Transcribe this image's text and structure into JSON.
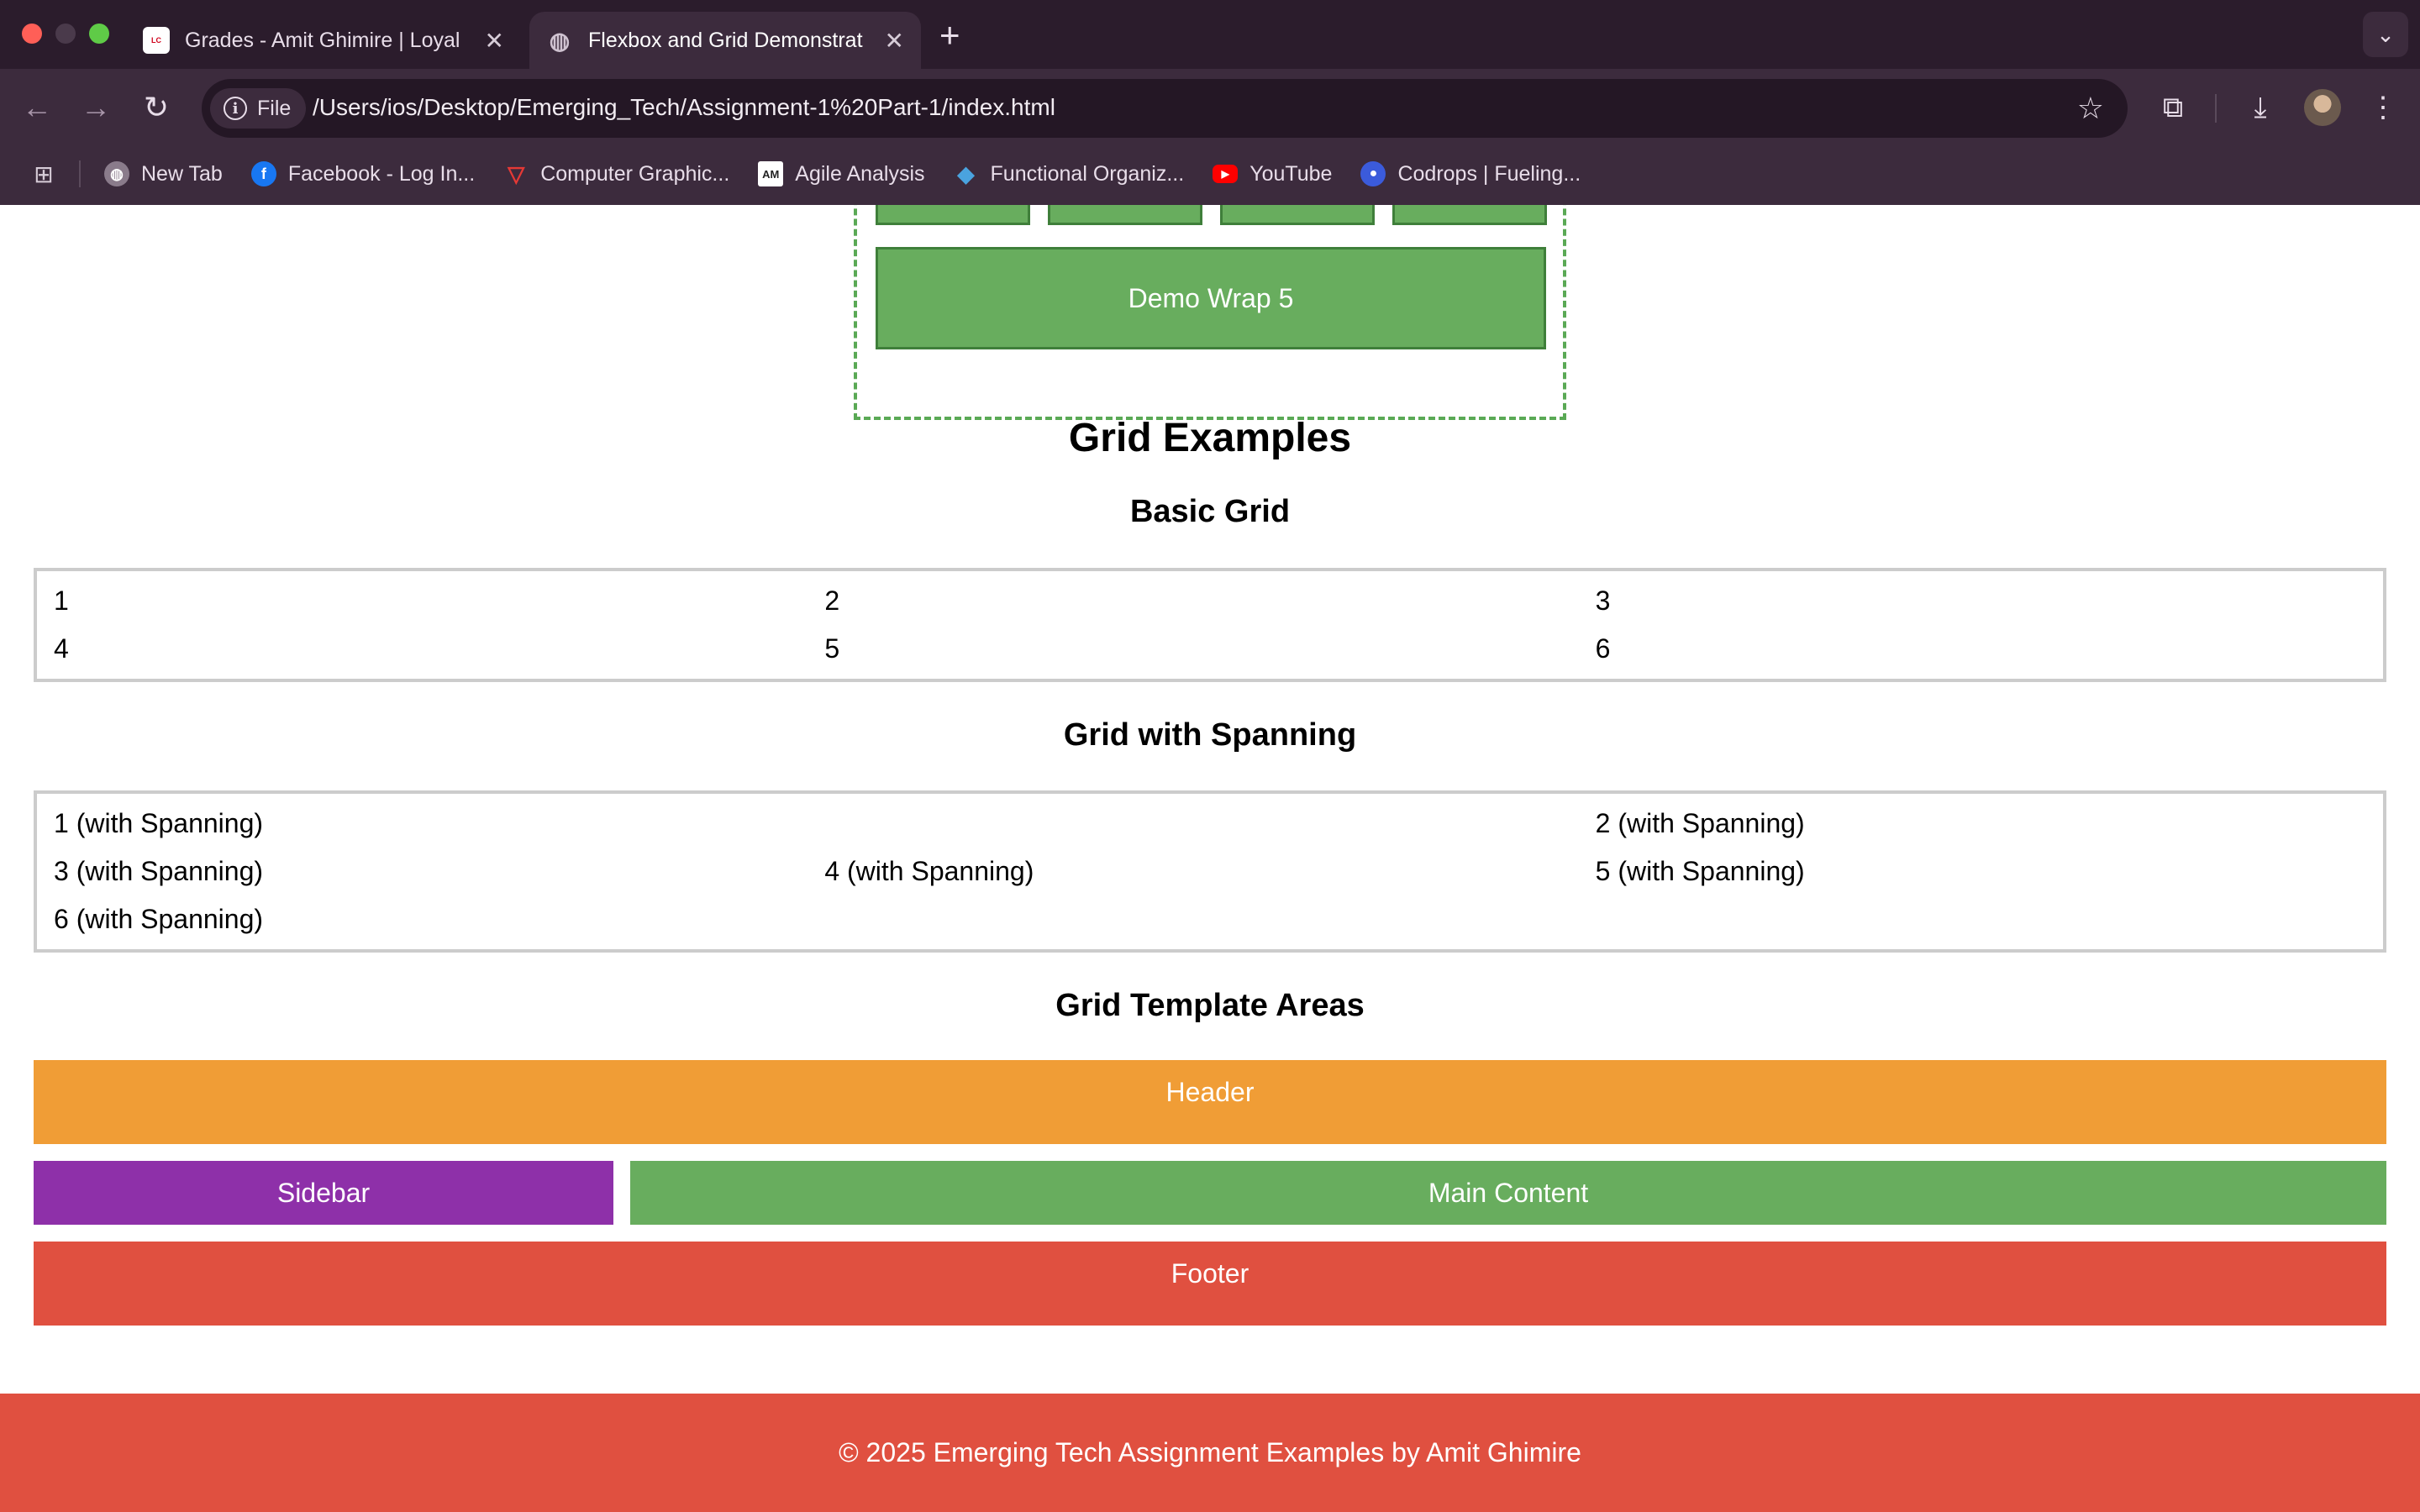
{
  "browser": {
    "tabs": [
      {
        "title": "Grades - Amit Ghimire | Loyal",
        "favicon": "loyalist-logo-icon",
        "active": false
      },
      {
        "title": "Flexbox and Grid Demonstrat",
        "favicon": "globe-icon",
        "active": true
      }
    ],
    "address": {
      "scheme_chip": "File",
      "url": "/Users/ios/Desktop/Emerging_Tech/Assignment-1%20Part-1/index.html"
    },
    "bookmarks": [
      {
        "label": "New Tab",
        "icon": "globe-icon",
        "color": "#8a7b8b"
      },
      {
        "label": "Facebook - Log In...",
        "icon": "facebook-icon",
        "color": "#1877f2"
      },
      {
        "label": "Computer Graphic...",
        "icon": "vector-logo-icon",
        "color": "#e53935"
      },
      {
        "label": "Agile Analysis",
        "icon": "am-logo-icon",
        "color": "#333333"
      },
      {
        "label": "Functional Organiz...",
        "icon": "diamond-logo-icon",
        "color": "#4aa3df"
      },
      {
        "label": "YouTube",
        "icon": "youtube-icon",
        "color": "#ff0000"
      },
      {
        "label": "Codrops | Fueling...",
        "icon": "codrops-icon",
        "color": "#3b5bdb"
      }
    ]
  },
  "page": {
    "flex_wrap": {
      "demo5_label": "Demo Wrap 5"
    },
    "grid_title": "Grid Examples",
    "basic_grid": {
      "title": "Basic Grid",
      "items": [
        "1",
        "2",
        "3",
        "4",
        "5",
        "6"
      ]
    },
    "spanning_grid": {
      "title": "Grid with Spanning",
      "items": [
        "1 (with Spanning)",
        "2 (with Spanning)",
        "3 (with Spanning)",
        "4 (with Spanning)",
        "5 (with Spanning)",
        "6 (with Spanning)"
      ]
    },
    "template_areas": {
      "title": "Grid Template Areas",
      "header": "Header",
      "sidebar": "Sidebar",
      "main": "Main Content",
      "footer": "Footer"
    },
    "footer_text": "© 2025 Emerging Tech Assignment Examples by Amit Ghimire"
  },
  "colors": {
    "header_area": "#f09d36",
    "sidebar_area": "#8e30a9",
    "main_area": "#68ad5e",
    "footer_area": "#e05040",
    "chrome_bg": "#3c2b3d"
  }
}
